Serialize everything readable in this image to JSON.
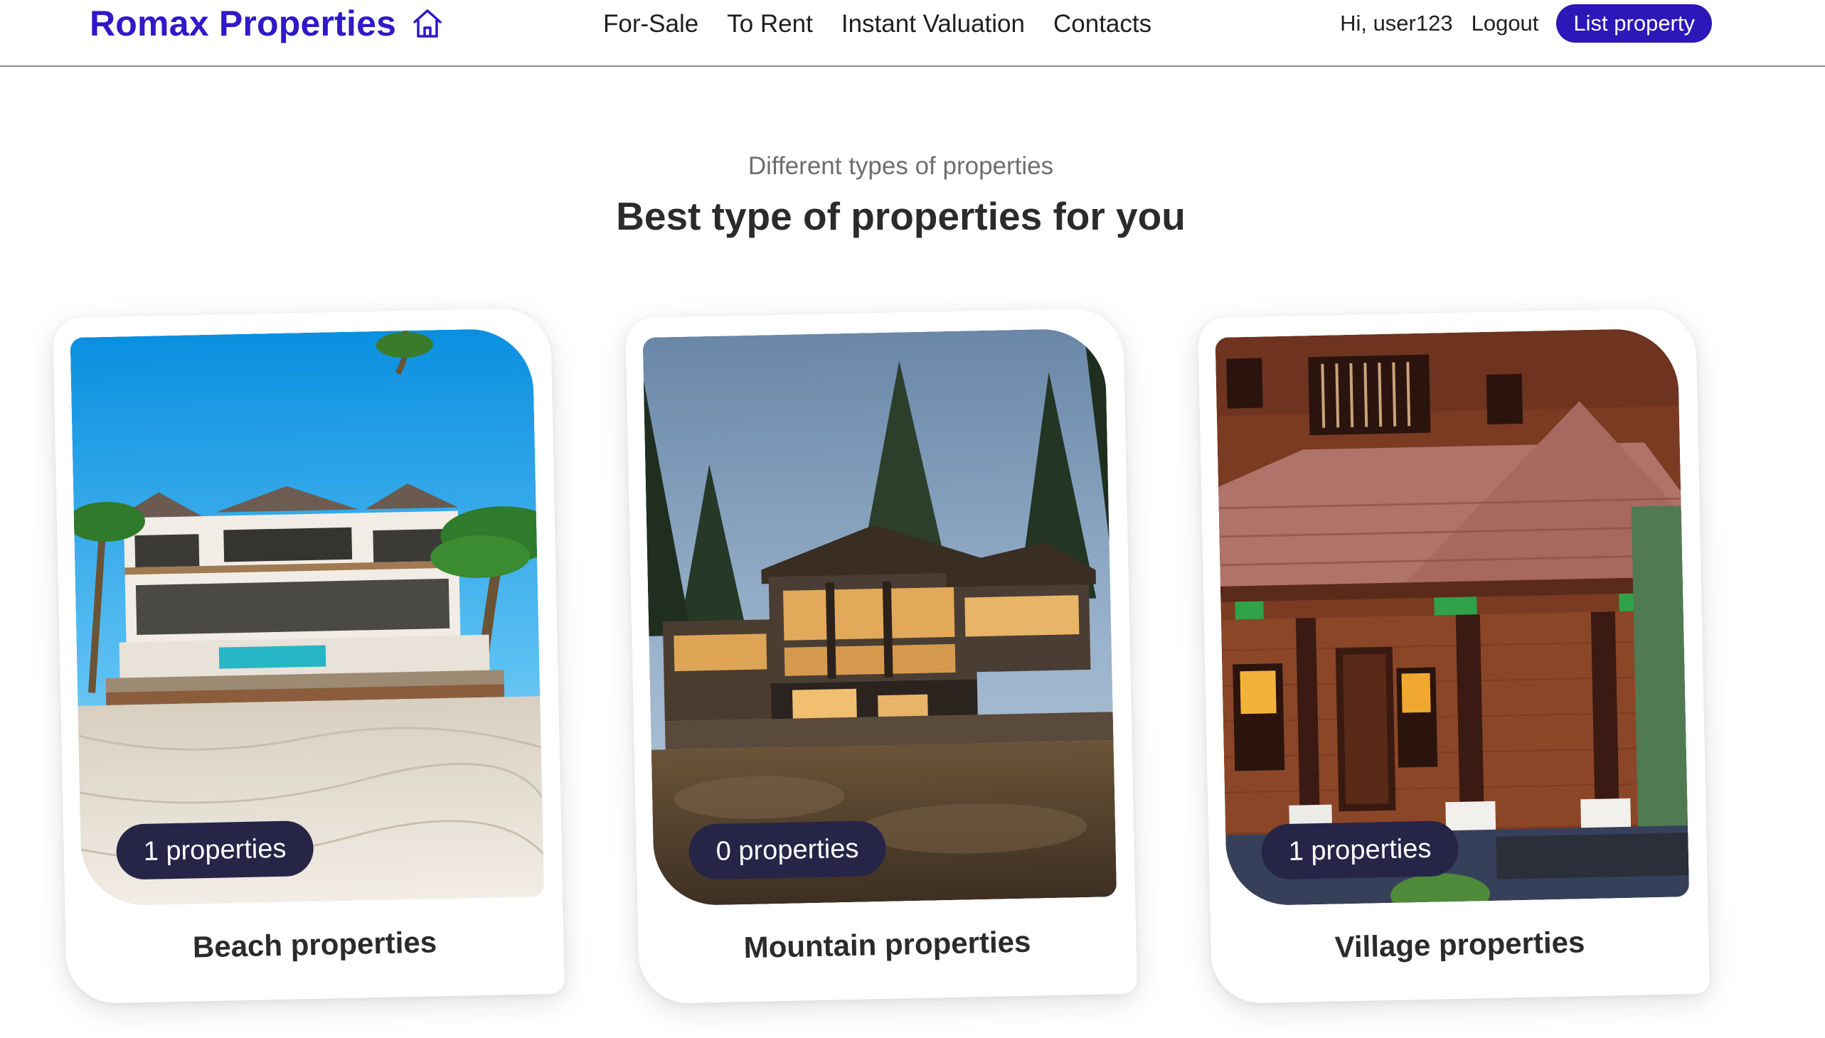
{
  "header": {
    "brand": "Romax Properties",
    "brand_icon": "home-outline-icon",
    "brand_color": "#2f19c9",
    "nav": [
      "For-Sale",
      "To Rent",
      "Instant Valuation",
      "Contacts"
    ],
    "greeting": "Hi, user123",
    "logout": "Logout",
    "list_property": "List property",
    "accent_color": "#2c17b8"
  },
  "section": {
    "subtitle": "Different types of properties",
    "title": "Best type of properties for you"
  },
  "cards": [
    {
      "badge": "1 properties",
      "label": "Beach properties",
      "image": "beach-villa-photo"
    },
    {
      "badge": "0 properties",
      "label": "Mountain properties",
      "image": "mountain-house-photo"
    },
    {
      "badge": "1 properties",
      "label": "Village properties",
      "image": "village-house-photo"
    }
  ],
  "badge_color": "#262548"
}
